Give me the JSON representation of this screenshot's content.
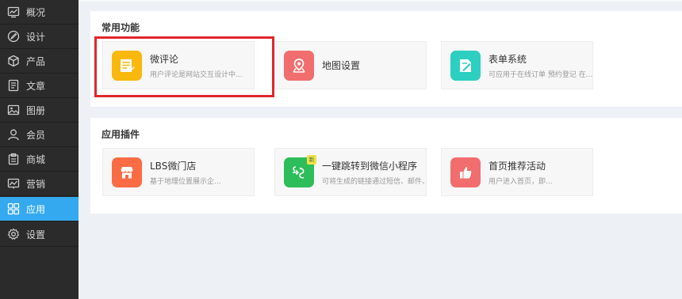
{
  "sidebar": {
    "items": [
      {
        "label": "概况",
        "icon": "overview-chart-icon"
      },
      {
        "label": "设计",
        "icon": "design-icon"
      },
      {
        "label": "产品",
        "icon": "product-box-icon"
      },
      {
        "label": "文章",
        "icon": "article-icon"
      },
      {
        "label": "图册",
        "icon": "gallery-icon"
      },
      {
        "label": "会员",
        "icon": "member-icon"
      },
      {
        "label": "商城",
        "icon": "mall-icon"
      },
      {
        "label": "营销",
        "icon": "marketing-icon"
      },
      {
        "label": "应用",
        "icon": "apps-grid-icon",
        "active": true
      },
      {
        "label": "设置",
        "icon": "settings-gear-icon"
      }
    ]
  },
  "sections": {
    "common": {
      "title": "常用功能",
      "cards": [
        {
          "name": "微评论",
          "desc": "用户评论是网站交互设计中...",
          "icon": "comment-list-icon",
          "color": "#f9b80d"
        },
        {
          "name": "地图设置",
          "desc": "",
          "icon": "map-pin-icon",
          "color": "#f26d6d"
        },
        {
          "name": "表单系统",
          "desc": "可应用于在线订单 预约登记 在...",
          "icon": "form-edit-icon",
          "color": "#2ccfc0"
        }
      ]
    },
    "plugins": {
      "title": "应用插件",
      "cards": [
        {
          "name": "LBS微门店",
          "desc": "基于地理位置展示企...",
          "icon": "store-icon",
          "color": "#fb6c45"
        },
        {
          "name": "一键跳转到微信小程序",
          "desc": "可将生成的链接通过短信、邮件、",
          "icon": "mini-program-icon",
          "color": "#2dbd5a",
          "badge": "新"
        },
        {
          "name": "首页推荐活动",
          "desc": "用户进入首页，即...",
          "icon": "thumbs-up-icon",
          "color": "#f26d6d"
        }
      ]
    }
  },
  "colors": {
    "sidebar_bg": "#2b2b2b",
    "active": "#35a9ef",
    "highlight": "#e0262c"
  }
}
